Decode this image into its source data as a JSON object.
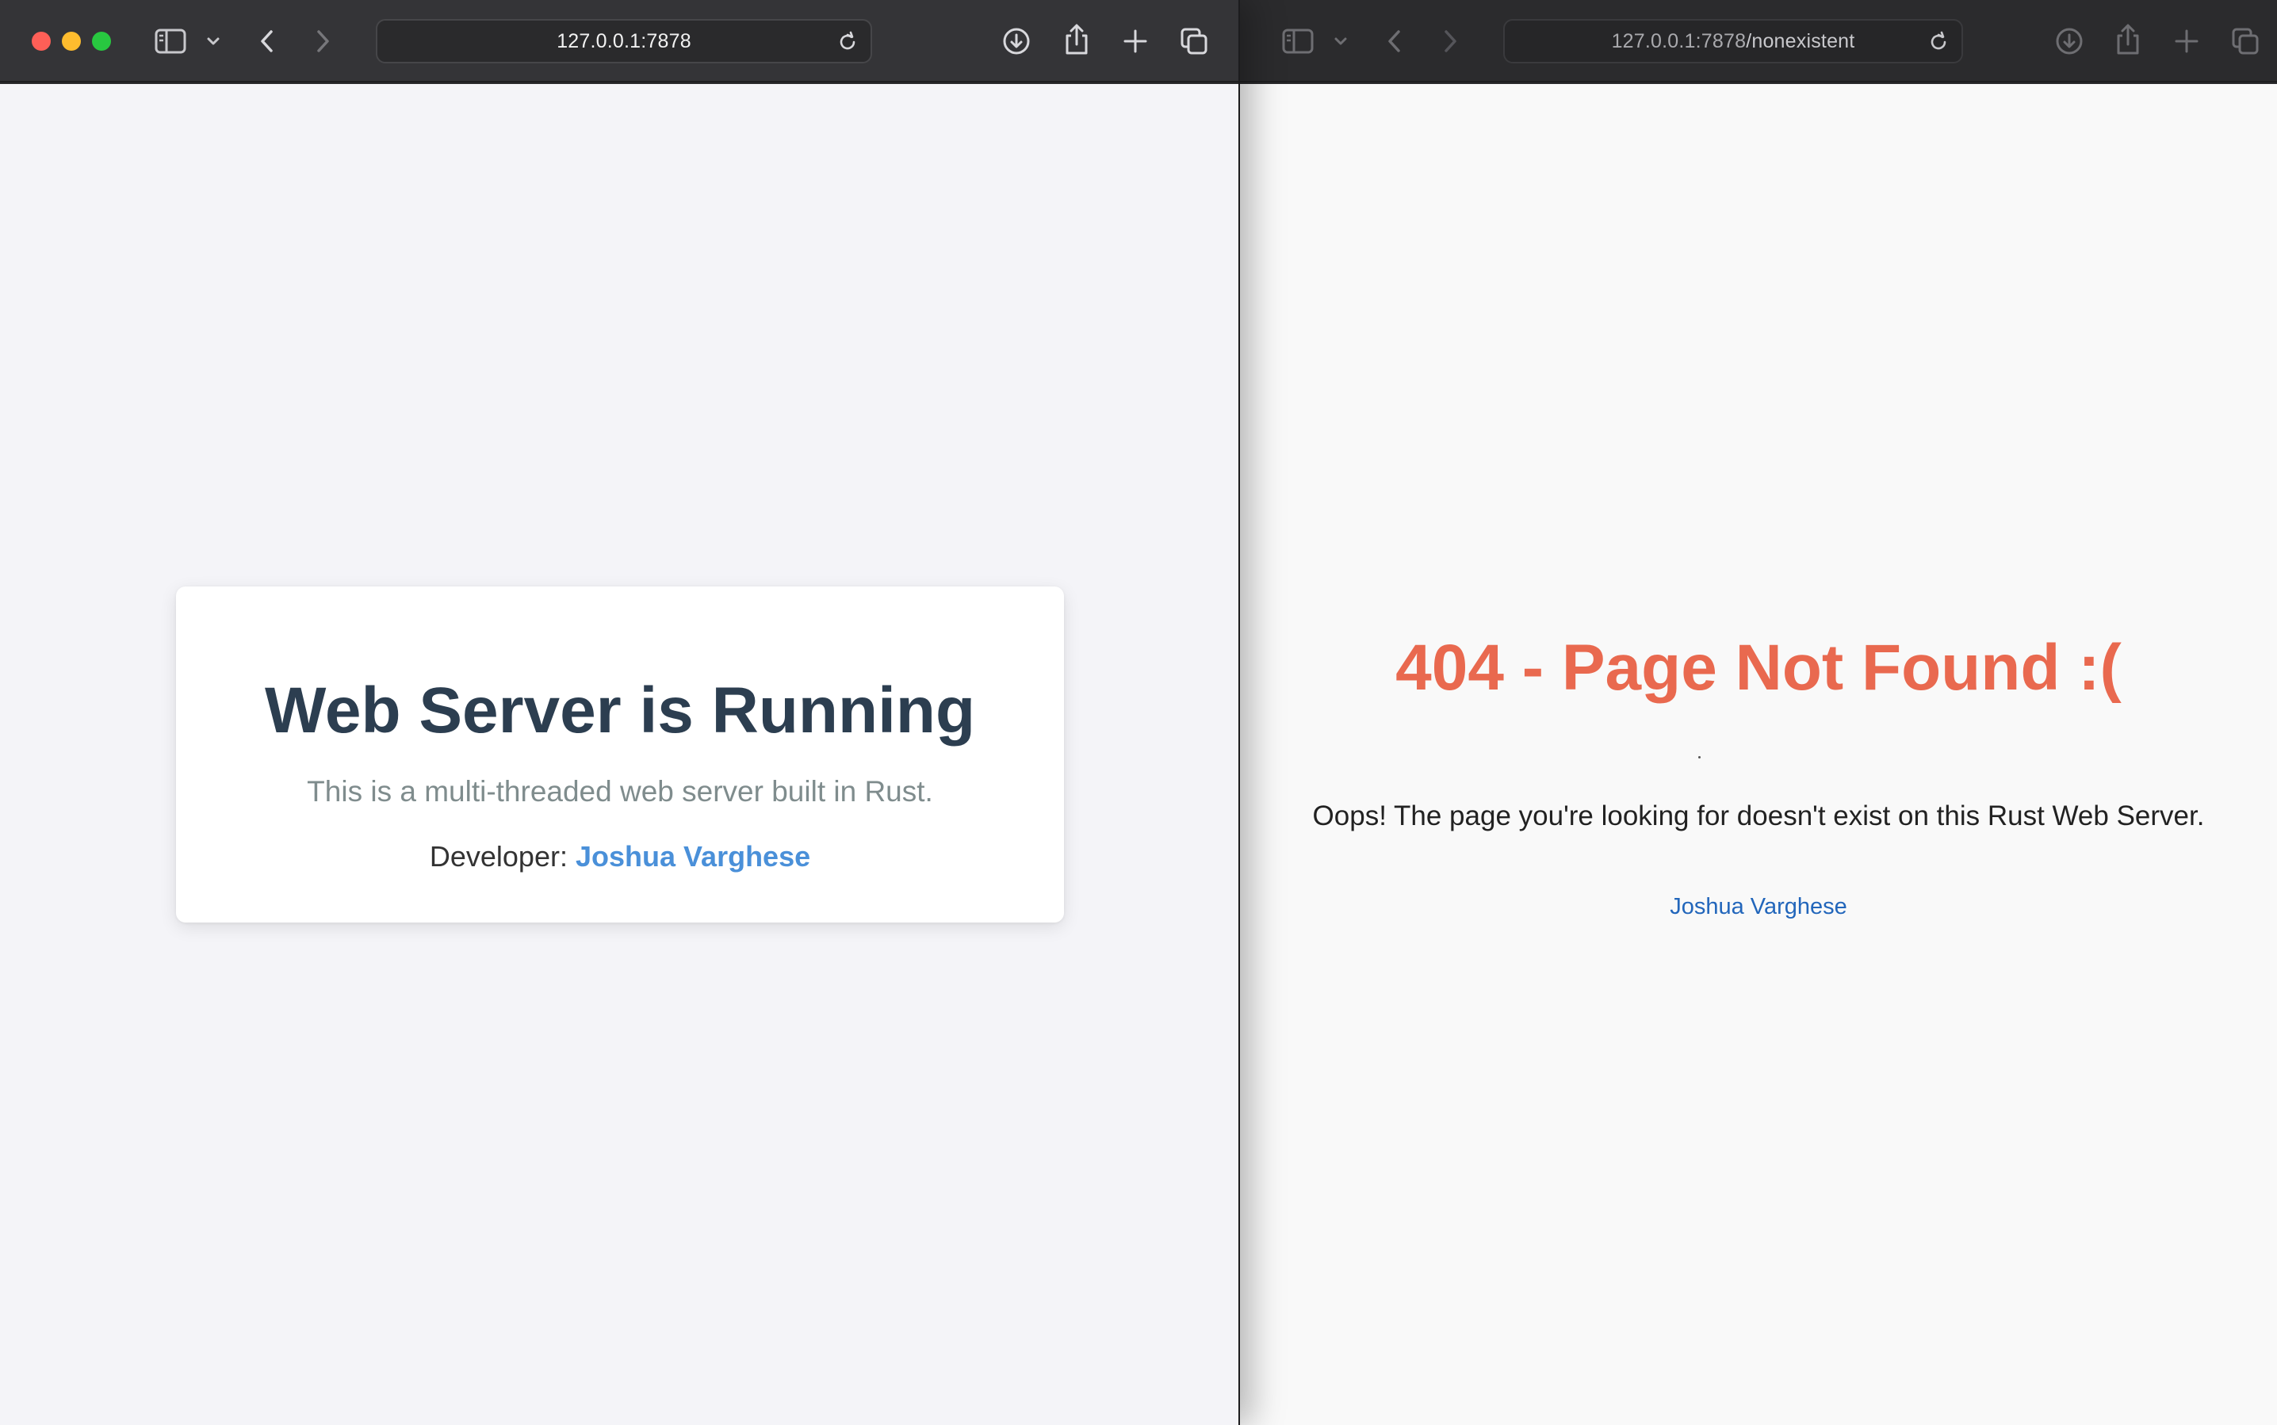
{
  "left_window": {
    "url": "127.0.0.1:7878",
    "card": {
      "title": "Web Server is Running",
      "subtitle": "This is a multi-threaded web server built in Rust.",
      "developer_label": "Developer:",
      "developer_name": "Joshua Varghese"
    },
    "toolbar_icons": [
      "sidebar-icon",
      "chevron-down-icon",
      "back-icon",
      "forward-icon",
      "reload-icon",
      "download-icon",
      "share-icon",
      "new-tab-icon",
      "tab-overview-icon"
    ]
  },
  "right_window": {
    "url_host": "127.0.0.1:7878",
    "url_path": "/nonexistent",
    "heading": "404 - Page Not Found :(",
    "message": "Oops! The page you're looking for doesn't exist on this Rust Web Server.",
    "link_text": "Joshua Varghese",
    "toolbar_icons": [
      "sidebar-icon",
      "chevron-down-icon",
      "back-icon",
      "forward-icon",
      "reload-icon",
      "download-icon",
      "share-icon",
      "new-tab-icon",
      "tab-overview-icon"
    ]
  },
  "colors": {
    "title_dark": "#2c3e50",
    "link_blue": "#4a90d9",
    "error_orange": "#e9694f",
    "traffic_red": "#fe5f57",
    "traffic_yellow": "#febc2e",
    "traffic_green": "#28c840"
  }
}
